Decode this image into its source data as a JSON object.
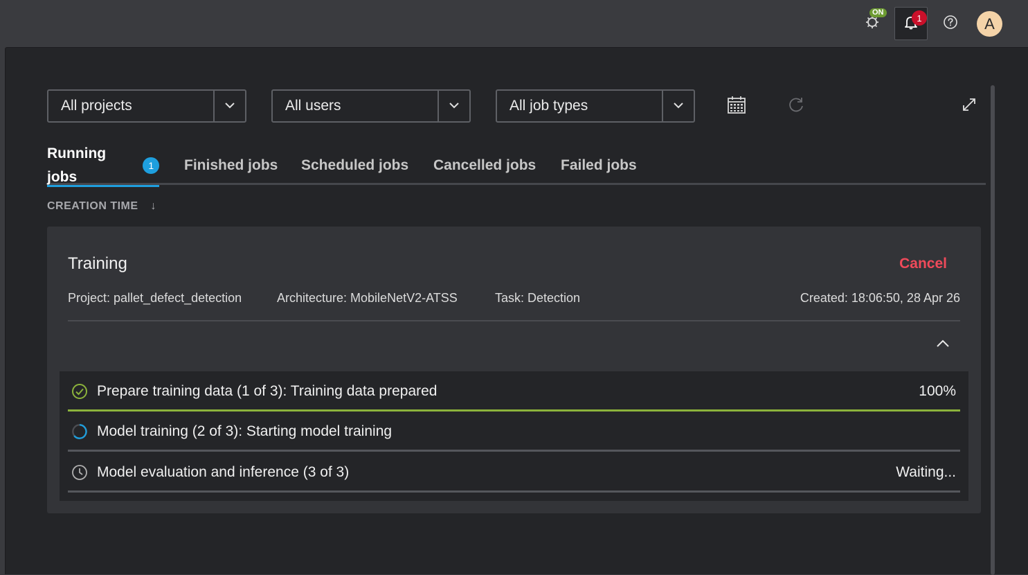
{
  "topbar": {
    "accelerator_badge": "ON",
    "notifications_count": "1",
    "avatar_letter": "A"
  },
  "filters": {
    "projects": "All projects",
    "users": "All users",
    "job_types": "All job types"
  },
  "tabs": {
    "running": "Running jobs",
    "running_count": "1",
    "finished": "Finished jobs",
    "scheduled": "Scheduled jobs",
    "cancelled": "Cancelled jobs",
    "failed": "Failed jobs"
  },
  "sort": {
    "label": "CREATION TIME",
    "direction_glyph": "↓"
  },
  "job": {
    "title": "Training",
    "cancel_label": "Cancel",
    "project": "Project: pallet_defect_detection",
    "architecture": "Architecture: MobileNetV2-ATSS",
    "task": "Task: Detection",
    "created": "Created: 18:06:50, 28 Apr 26",
    "steps": [
      {
        "label": "Prepare training data (1 of 3): Training data prepared",
        "status": "100%",
        "progress": 1.0
      },
      {
        "label": "Model training (2 of 3): Starting model training",
        "status": "",
        "progress": 0
      },
      {
        "label": "Model evaluation and inference (3 of 3)",
        "status": "Waiting...",
        "progress": 0
      }
    ]
  },
  "colors": {
    "accent": "#1e9fde",
    "success": "#8cb33c",
    "danger": "#ef4a5a",
    "panel_bg": "#242528",
    "card_bg": "#333438"
  }
}
